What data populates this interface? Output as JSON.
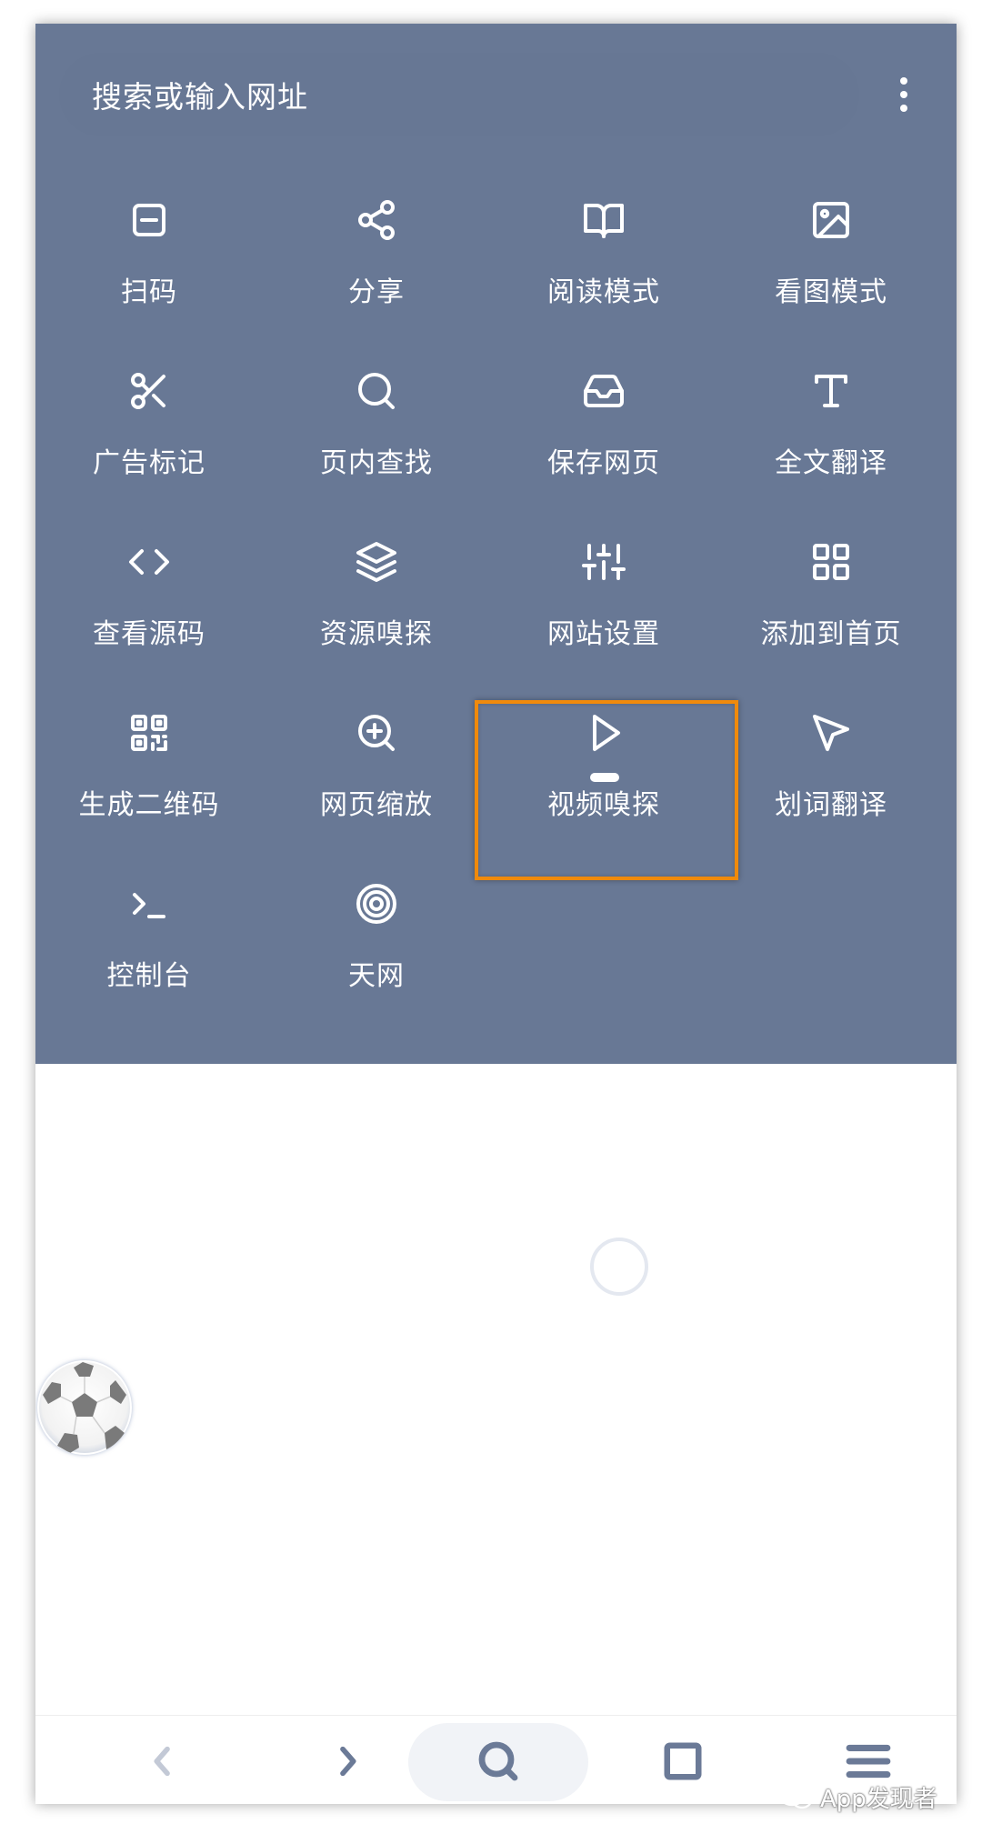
{
  "search": {
    "placeholder": "搜索或输入网址"
  },
  "menu": {
    "items": [
      {
        "label": "扫码",
        "icon": "scan-icon"
      },
      {
        "label": "分享",
        "icon": "share-icon"
      },
      {
        "label": "阅读模式",
        "icon": "book-open-icon"
      },
      {
        "label": "看图模式",
        "icon": "image-icon"
      },
      {
        "label": "广告标记",
        "icon": "scissors-icon"
      },
      {
        "label": "页内查找",
        "icon": "search-icon"
      },
      {
        "label": "保存网页",
        "icon": "inbox-icon"
      },
      {
        "label": "全文翻译",
        "icon": "text-t-icon"
      },
      {
        "label": "查看源码",
        "icon": "code-icon"
      },
      {
        "label": "资源嗅探",
        "icon": "layers-icon"
      },
      {
        "label": "网站设置",
        "icon": "sliders-icon"
      },
      {
        "label": "添加到首页",
        "icon": "grid-icon"
      },
      {
        "label": "生成二维码",
        "icon": "qr-code-icon"
      },
      {
        "label": "网页缩放",
        "icon": "zoom-in-icon"
      },
      {
        "label": "视频嗅探",
        "icon": "play-icon"
      },
      {
        "label": "划词翻译",
        "icon": "cursor-arrow-icon"
      },
      {
        "label": "控制台",
        "icon": "terminal-icon"
      },
      {
        "label": "天网",
        "icon": "target-icon"
      }
    ],
    "highlighted_item": "视频嗅探",
    "highlight_color": "#f08a0c",
    "panel_color": "#687895"
  },
  "bottom_nav": {
    "icons": [
      "back-icon",
      "forward-icon",
      "search-icon",
      "tabs-icon",
      "menu-icon"
    ],
    "back_enabled": false
  },
  "watermark": {
    "text": "App发现者"
  }
}
